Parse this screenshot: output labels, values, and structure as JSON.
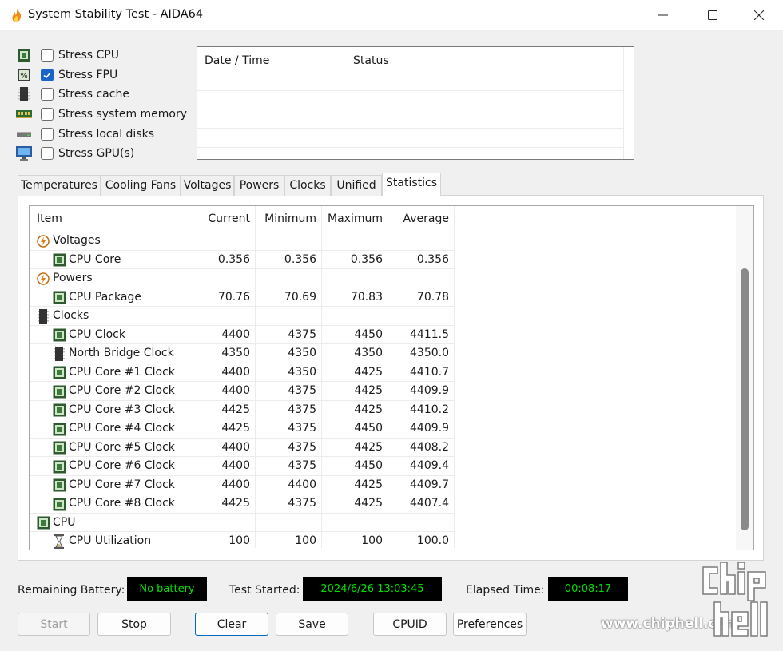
{
  "window": {
    "title": "System Stability Test - AIDA64",
    "app_icon": "flame-icon",
    "controls": [
      "minimize-icon",
      "maximize-icon",
      "close-icon"
    ]
  },
  "stress_options": [
    {
      "label": "Stress CPU",
      "checked": false,
      "icon": "cpu-chip-icon"
    },
    {
      "label": "Stress FPU",
      "checked": true,
      "icon": "fpu-chip-icon"
    },
    {
      "label": "Stress cache",
      "checked": false,
      "icon": "cache-chip-icon"
    },
    {
      "label": "Stress system memory",
      "checked": false,
      "icon": "memory-icon"
    },
    {
      "label": "Stress local disks",
      "checked": false,
      "icon": "disk-icon"
    },
    {
      "label": "Stress GPU(s)",
      "checked": false,
      "icon": "monitor-icon"
    }
  ],
  "log": {
    "columns": [
      "Date / Time",
      "Status"
    ],
    "rows": []
  },
  "tabs": [
    {
      "label": "Temperatures"
    },
    {
      "label": "Cooling Fans"
    },
    {
      "label": "Voltages"
    },
    {
      "label": "Powers"
    },
    {
      "label": "Clocks"
    },
    {
      "label": "Unified"
    },
    {
      "label": "Statistics",
      "active": true
    }
  ],
  "stats": {
    "columns": [
      "Item",
      "Current",
      "Minimum",
      "Maximum",
      "Average"
    ],
    "rows": [
      {
        "group": true,
        "name": "Voltages",
        "icon": "lightning-icon"
      },
      {
        "name": "CPU Core",
        "icon": "cpu-chip-icon",
        "current": "0.356",
        "minimum": "0.356",
        "maximum": "0.356",
        "average": "0.356"
      },
      {
        "group": true,
        "name": "Powers",
        "icon": "lightning-icon"
      },
      {
        "name": "CPU Package",
        "icon": "cpu-chip-icon",
        "current": "70.76",
        "minimum": "70.69",
        "maximum": "70.83",
        "average": "70.78"
      },
      {
        "group": true,
        "name": "Clocks",
        "icon": "bridge-chip-icon"
      },
      {
        "name": "CPU Clock",
        "icon": "cpu-chip-icon",
        "current": "4400",
        "minimum": "4375",
        "maximum": "4450",
        "average": "4411.5"
      },
      {
        "name": "North Bridge Clock",
        "icon": "bridge-chip-icon",
        "current": "4350",
        "minimum": "4350",
        "maximum": "4350",
        "average": "4350.0"
      },
      {
        "name": "CPU Core #1 Clock",
        "icon": "cpu-chip-icon",
        "current": "4400",
        "minimum": "4350",
        "maximum": "4425",
        "average": "4410.7"
      },
      {
        "name": "CPU Core #2 Clock",
        "icon": "cpu-chip-icon",
        "current": "4400",
        "minimum": "4375",
        "maximum": "4425",
        "average": "4409.9"
      },
      {
        "name": "CPU Core #3 Clock",
        "icon": "cpu-chip-icon",
        "current": "4425",
        "minimum": "4375",
        "maximum": "4425",
        "average": "4410.2"
      },
      {
        "name": "CPU Core #4 Clock",
        "icon": "cpu-chip-icon",
        "current": "4425",
        "minimum": "4375",
        "maximum": "4450",
        "average": "4409.9"
      },
      {
        "name": "CPU Core #5 Clock",
        "icon": "cpu-chip-icon",
        "current": "4400",
        "minimum": "4375",
        "maximum": "4425",
        "average": "4408.2"
      },
      {
        "name": "CPU Core #6 Clock",
        "icon": "cpu-chip-icon",
        "current": "4400",
        "minimum": "4375",
        "maximum": "4450",
        "average": "4409.4"
      },
      {
        "name": "CPU Core #7 Clock",
        "icon": "cpu-chip-icon",
        "current": "4400",
        "minimum": "4400",
        "maximum": "4425",
        "average": "4409.7"
      },
      {
        "name": "CPU Core #8 Clock",
        "icon": "cpu-chip-icon",
        "current": "4425",
        "minimum": "4375",
        "maximum": "4425",
        "average": "4407.4"
      },
      {
        "group": true,
        "name": "CPU",
        "icon": "cpu-chip-icon"
      },
      {
        "name": "CPU Utilization",
        "icon": "hourglass-icon",
        "current": "100",
        "minimum": "100",
        "maximum": "100",
        "average": "100.0"
      }
    ]
  },
  "status": {
    "battery_label": "Remaining Battery:",
    "battery_value": "No battery",
    "started_label": "Test Started:",
    "started_value": "2024/6/26 13:03:45",
    "elapsed_label": "Elapsed Time:",
    "elapsed_value": "00:08:17"
  },
  "buttons": {
    "start": "Start",
    "stop": "Stop",
    "clear": "Clear",
    "save": "Save",
    "cpuid": "CPUID",
    "preferences": "Preferences"
  },
  "watermark": {
    "site": "www.chiphell.com",
    "logo_text": "chip hell"
  },
  "colors": {
    "led_bg": "#000000",
    "led_text": "#00e000",
    "checkbox_checked": "#1a64c8",
    "scroll_thumb": "#8a8a8a"
  }
}
